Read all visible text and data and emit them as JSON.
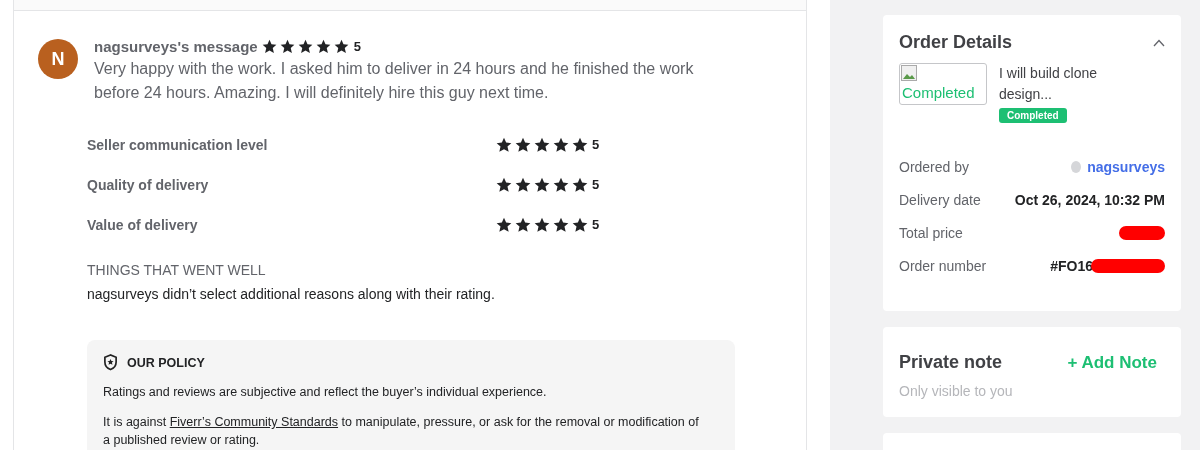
{
  "review": {
    "avatar_initial": "N",
    "author": "nagsurveys's message",
    "stars": 5,
    "score": "5",
    "text": "Very happy with the work. I asked him to deliver in 24 hours and he finished the work before 24 hours. Amazing. I will definitely hire this guy next time.",
    "ratings": [
      {
        "label": "Seller communication level",
        "stars": 5,
        "score": "5"
      },
      {
        "label": "Quality of delivery",
        "stars": 5,
        "score": "5"
      },
      {
        "label": "Value of delivery",
        "stars": 5,
        "score": "5"
      }
    ],
    "went_well": {
      "heading": "THINGS THAT WENT WELL",
      "text": "nagsurveys didn’t select additional reasons along with their rating."
    },
    "policy": {
      "heading": "OUR POLICY",
      "paragraphs": [
        {
          "before": "Ratings and reviews are subjective and reflect the buyer’s individual experience."
        },
        {
          "before": "It is against ",
          "link": "Fiverr’s Community Standards",
          "after": " to manipulate, pressure, or ask for the removal or modification of a published review or rating."
        }
      ]
    }
  },
  "order_details": {
    "title": "Order Details",
    "expanded": true,
    "image_alt": "Completed",
    "gig_title": "I will build clone design...",
    "status": "Completed",
    "fields": [
      {
        "label": "Ordered by",
        "value": "nagsurveys",
        "kind": "user"
      },
      {
        "label": "Delivery date",
        "value": "Oct 26, 2024, 10:32 PM",
        "kind": "text"
      },
      {
        "label": "Total price",
        "kind": "redacted"
      },
      {
        "label": "Order number",
        "value": "#FO16",
        "kind": "partly_redacted"
      }
    ]
  },
  "private_note": {
    "title": "Private note",
    "action": "+ Add Note",
    "hint": "Only visible to you"
  }
}
